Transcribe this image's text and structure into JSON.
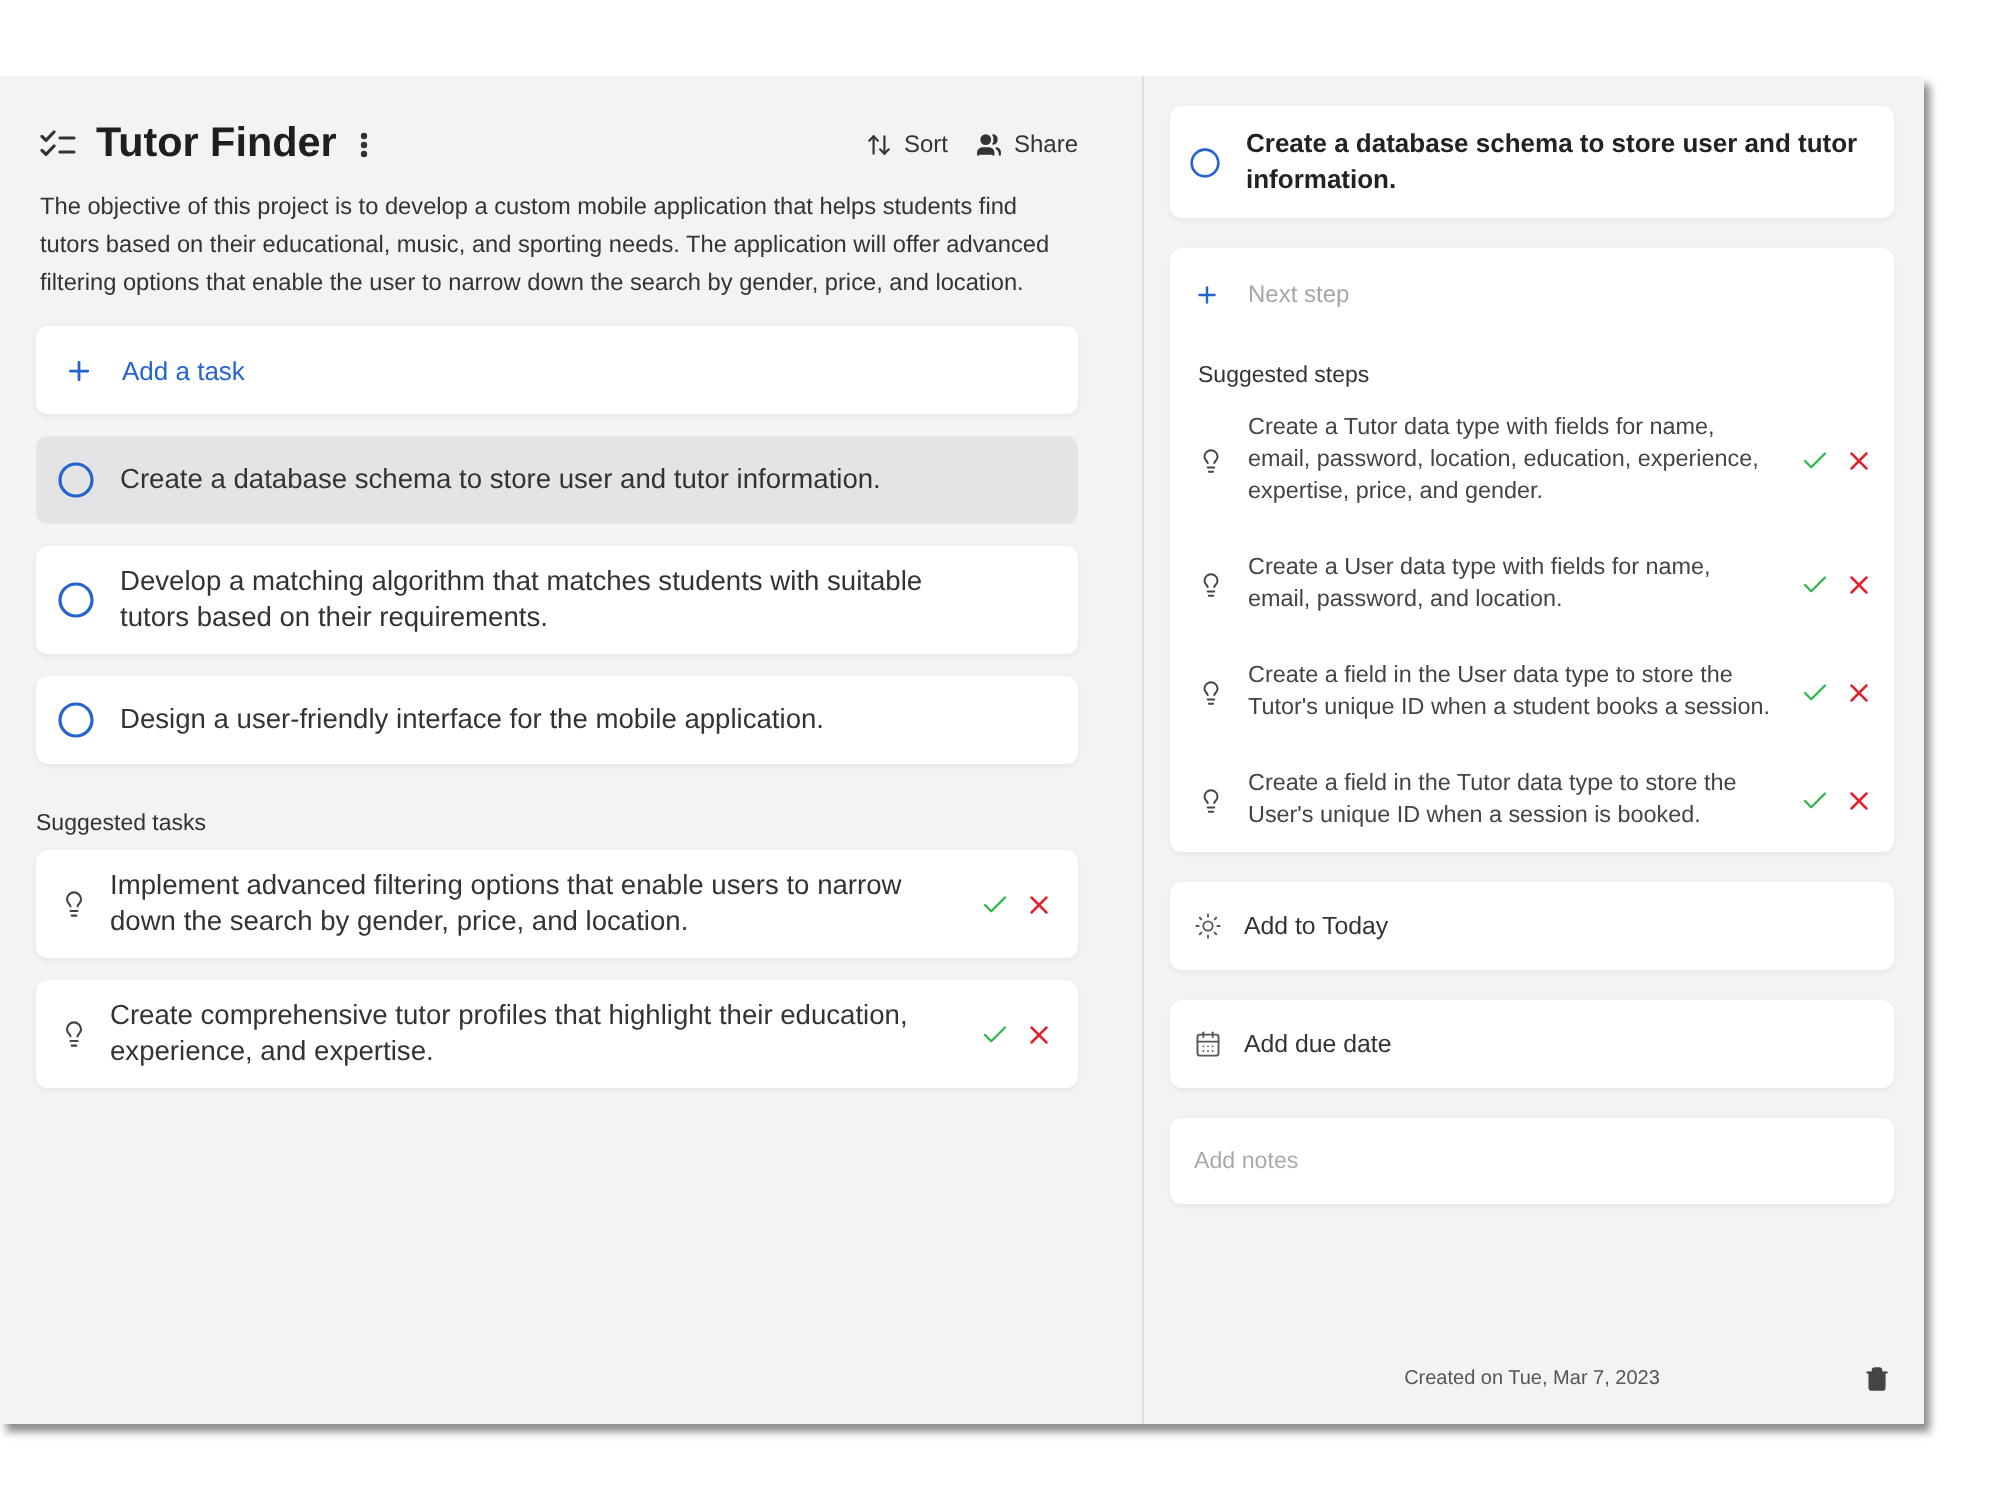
{
  "project": {
    "title": "Tutor Finder",
    "actions": [
      {
        "kind": "sort",
        "label": "Sort"
      },
      {
        "kind": "share",
        "label": "Share"
      }
    ],
    "description": "The objective of this project is to develop a custom mobile application that helps students find tutors based on their educational, music, and sporting needs. The application will offer advanced filtering options that enable the user to narrow down the search by gender, price, and location."
  },
  "add_task": {
    "placeholder": "Add a task"
  },
  "tasks": [
    {
      "text": "Create a database schema to store user and tutor information.",
      "checked": false,
      "selected": true
    },
    {
      "text": "Develop a matching algorithm that matches students with suitable tutors based on their requirements.",
      "checked": false,
      "selected": false
    },
    {
      "text": "Design a user-friendly interface for the mobile application.",
      "checked": false,
      "selected": false
    }
  ],
  "suggested_tasks": {
    "heading": "Suggested tasks",
    "items": [
      {
        "text": "Implement advanced filtering options that enable users to narrow down the search by gender, price, and location."
      },
      {
        "text": "Create comprehensive tutor profiles that highlight their education, experience, and expertise."
      }
    ]
  },
  "detail": {
    "task": {
      "text": "Create a database schema to store user and tutor information.",
      "checked": false
    },
    "next_step": {
      "placeholder": "Next step"
    },
    "suggested_steps": {
      "heading": "Suggested steps",
      "items": [
        {
          "text": "Create a Tutor data type with fields for name, email, password, location, education, experience, expertise, price, and gender."
        },
        {
          "text": "Create a User data type with fields for name, email, password, and location."
        },
        {
          "text": "Create a field in the User data type to store the Tutor's unique ID when a student books a session."
        },
        {
          "text": "Create a field in the Tutor data type to store the User's unique ID when a session is booked."
        }
      ]
    },
    "actions": [
      {
        "kind": "today",
        "label": "Add to Today"
      },
      {
        "kind": "due_date",
        "label": "Add due date"
      }
    ],
    "notes": {
      "placeholder": "Add notes"
    },
    "created": "Created on Tue, Mar 7, 2023"
  }
}
